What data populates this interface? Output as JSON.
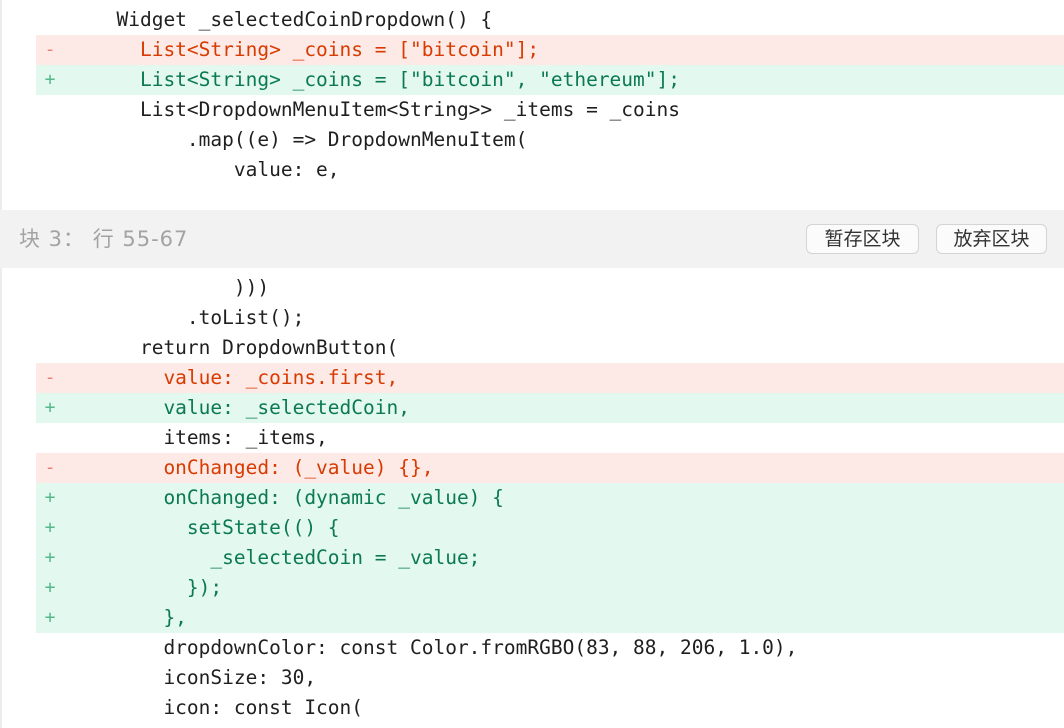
{
  "diff_top": [
    {
      "type": "ctx",
      "marker": "",
      "text": "  Widget _selectedCoinDropdown() {"
    },
    {
      "type": "del",
      "marker": "-",
      "text": "    List<String> _coins = [\"bitcoin\"];"
    },
    {
      "type": "add",
      "marker": "+",
      "text": "    List<String> _coins = [\"bitcoin\", \"ethereum\"];"
    },
    {
      "type": "ctx",
      "marker": "",
      "text": "    List<DropdownMenuItem<String>> _items = _coins"
    },
    {
      "type": "ctx",
      "marker": "",
      "text": "        .map((e) => DropdownMenuItem("
    },
    {
      "type": "ctx",
      "marker": "",
      "text": "            value: e,"
    }
  ],
  "hunk": {
    "title": "块 3： 行 55-67",
    "stage_label": "暂存区块",
    "discard_label": "放弃区块"
  },
  "diff_bottom": [
    {
      "type": "ctx",
      "marker": "",
      "text": "            )))"
    },
    {
      "type": "ctx",
      "marker": "",
      "text": "        .toList();"
    },
    {
      "type": "ctx",
      "marker": "",
      "text": "    return DropdownButton("
    },
    {
      "type": "del",
      "marker": "-",
      "text": "      value: _coins.first,"
    },
    {
      "type": "add",
      "marker": "+",
      "text": "      value: _selectedCoin,"
    },
    {
      "type": "ctx",
      "marker": "",
      "text": "      items: _items,"
    },
    {
      "type": "del",
      "marker": "-",
      "text": "      onChanged: (_value) {},"
    },
    {
      "type": "add",
      "marker": "+",
      "text": "      onChanged: (dynamic _value) {"
    },
    {
      "type": "add",
      "marker": "+",
      "text": "        setState(() {"
    },
    {
      "type": "add",
      "marker": "+",
      "text": "          _selectedCoin = _value;"
    },
    {
      "type": "add",
      "marker": "+",
      "text": "        });"
    },
    {
      "type": "add",
      "marker": "+",
      "text": "      },"
    },
    {
      "type": "ctx",
      "marker": "",
      "text": "      dropdownColor: const Color.fromRGBO(83, 88, 206, 1.0),"
    },
    {
      "type": "ctx",
      "marker": "",
      "text": "      iconSize: 30,"
    },
    {
      "type": "ctx",
      "marker": "",
      "text": "      icon: const Icon("
    }
  ],
  "colors": {
    "deleted_bg": "#fde9e5",
    "deleted_text": "#d83b01",
    "added_bg": "#e3f8ee",
    "added_text": "#0b7a4f",
    "hunk_header_bg": "#f2f2f2"
  }
}
